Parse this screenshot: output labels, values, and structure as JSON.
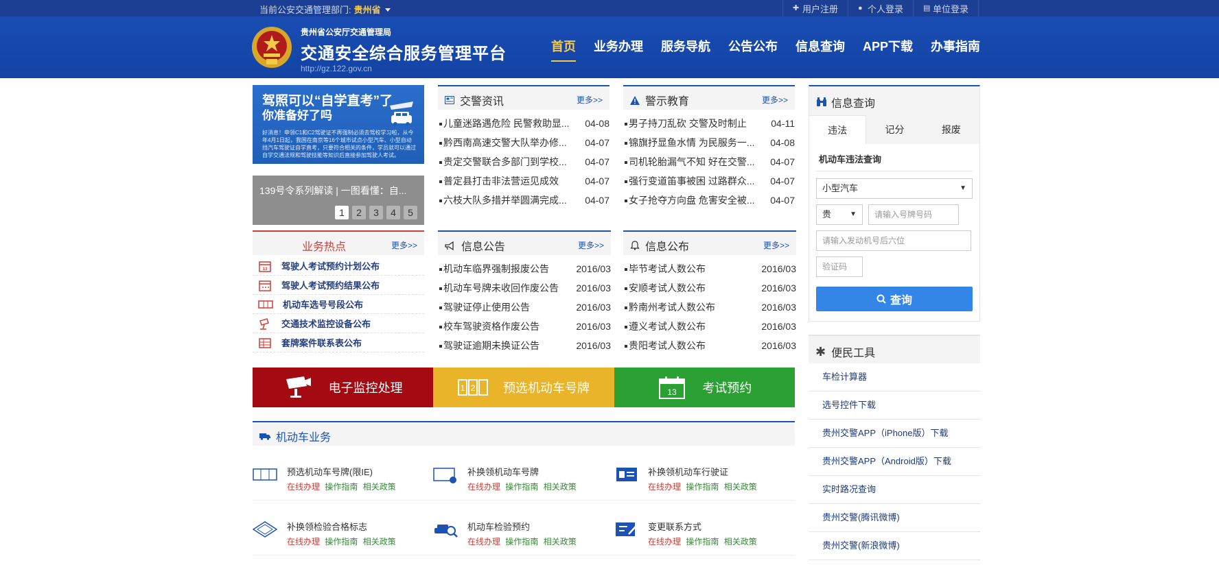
{
  "topbar": {
    "dept_label": "当前公安交通管理部门:",
    "dept_value": "贵州省",
    "links": [
      "用户注册",
      "个人登录",
      "单位登录"
    ]
  },
  "header": {
    "org": "贵州省公安厅交通管理局",
    "title": "交通安全综合服务管理平台",
    "url": "http://gz.122.gov.cn"
  },
  "nav": [
    "首页",
    "业务办理",
    "服务导航",
    "公告公布",
    "信息查询",
    "APP下载",
    "办事指南"
  ],
  "banner": {
    "headline1": "驾照可以“自学直考”了",
    "headline2": "你准备好了吗",
    "fine": "好消息！申领C1和C2驾驶证不再强制必须去驾校学习啦，从今年4月1日起，我国在南京等16个城市试点小型汽车、小型自动挡汽车驾驶证自学直考，只要符合相关的条件，学员就可以通过自学交通法规和驾驶技能等知识后直接参加驾驶人考试。"
  },
  "slider": {
    "caption": "139号令系列解读 | 一图看懂：自...",
    "dots": [
      "1",
      "2",
      "3",
      "4",
      "5"
    ]
  },
  "hot": {
    "title": "业务热点",
    "more": "更多>>",
    "items": [
      "驾驶人考试预约计划公布",
      "驾驶人考试预约结果公布",
      "机动车选号号段公布",
      "交通技术监控设备公布",
      "套牌案件联系表公布"
    ]
  },
  "traffic_news": {
    "title": "交警资讯",
    "more": "更多>>",
    "items": [
      {
        "t": "儿童迷路遇危险 民警救助显...",
        "d": "04-08"
      },
      {
        "t": "黔西南高速交警大队举办修...",
        "d": "04-07"
      },
      {
        "t": "贵定交警联合多部门到学校...",
        "d": "04-07"
      },
      {
        "t": "普定县打击非法营运见成效",
        "d": "04-07"
      },
      {
        "t": "六枝大队多措并举圆满完成...",
        "d": "04-07"
      }
    ]
  },
  "warning": {
    "title": "警示教育",
    "more": "更多>>",
    "items": [
      {
        "t": "男子持刀乱砍 交警及时制止",
        "d": "04-11"
      },
      {
        "t": "锦旗抒显鱼水情 为民服务一...",
        "d": "04-08"
      },
      {
        "t": "司机轮胎漏气不知 好在交警...",
        "d": "04-07"
      },
      {
        "t": "强行变道笛事被困 过路群众...",
        "d": "04-07"
      },
      {
        "t": "女子抢夺方向盘 危害安全被...",
        "d": "04-07"
      }
    ]
  },
  "notices": {
    "title": "信息公告",
    "more": "更多>>",
    "items": [
      {
        "t": "机动车临界强制报废公告",
        "d": "2016/03"
      },
      {
        "t": "机动车号牌未收回作废公告",
        "d": "2016/03"
      },
      {
        "t": "驾驶证停止使用公告",
        "d": "2016/03"
      },
      {
        "t": "校车驾驶资格作废公告",
        "d": "2016/03"
      },
      {
        "t": "驾驶证逾期未换证公告",
        "d": "2016/03"
      }
    ]
  },
  "publish": {
    "title": "信息公布",
    "more": "更多>>",
    "items": [
      {
        "t": "毕节考试人数公布",
        "d": "2016/03"
      },
      {
        "t": "安顺考试人数公布",
        "d": "2016/03"
      },
      {
        "t": "黔南州考试人数公布",
        "d": "2016/03"
      },
      {
        "t": "遵义考试人数公布",
        "d": "2016/03"
      },
      {
        "t": "贵阳考试人数公布",
        "d": "2016/03"
      }
    ]
  },
  "big_buttons": [
    "电子监控处理",
    "预选机动车号牌",
    "考试预约"
  ],
  "calendar_day": "13",
  "vehicle": {
    "title": "机动车业务",
    "op_online": "在线办理",
    "op_guide": "操作指南",
    "op_policy": "相关政策",
    "items": [
      "预选机动车号牌(限IE)",
      "补换领机动车号牌",
      "补换领机动车行驶证",
      "补换领检验合格标志",
      "机动车检验预约",
      "变更联系方式"
    ]
  },
  "info_query": {
    "title": "信息查询",
    "tabs": [
      "违法",
      "记分",
      "报废"
    ],
    "form_label": "机动车违法查询",
    "vehicle_type": "小型汽车",
    "province": "贵",
    "plate_placeholder": "请输入号牌号码",
    "engine_placeholder": "请输入发动机号后六位",
    "captcha_placeholder": "验证码",
    "submit": "查询"
  },
  "tools": {
    "title": "便民工具",
    "items": [
      "车检计算器",
      "选号控件下载",
      "贵州交警APP（iPhone版）下载",
      "贵州交警APP（Android版）下载",
      "实时路况查询",
      "贵州交警(腾讯微博)",
      "贵州交警(新浪微博)"
    ]
  },
  "colors": {
    "brand": "#1243a4",
    "accent": "#f6c948",
    "red": "#a30a12",
    "yellow": "#e9b32a",
    "green": "#2ba134",
    "query_button": "#3385e6"
  }
}
